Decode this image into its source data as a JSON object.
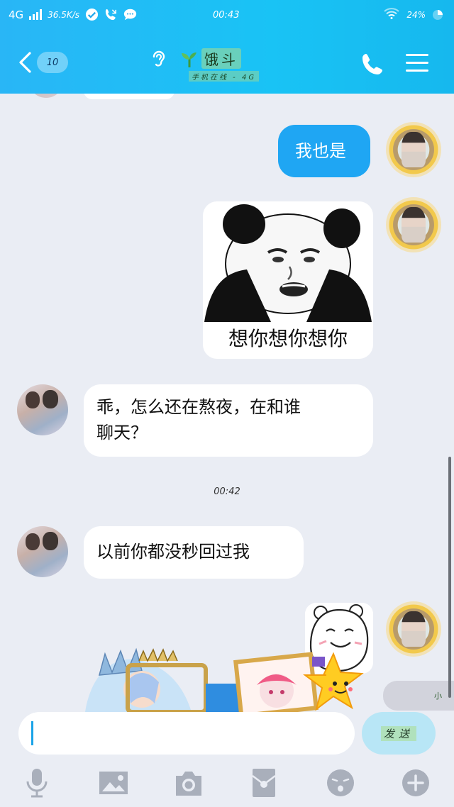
{
  "status_bar": {
    "network": "4G",
    "speed": "36.5K/s",
    "time": "00:43",
    "battery": "24%"
  },
  "header": {
    "unread_count": "10",
    "contact_name": "饿斗",
    "contact_status": "手机在线 - 4G"
  },
  "messages": [
    {
      "sender": "self",
      "type": "text",
      "text": "我也是"
    },
    {
      "sender": "self",
      "type": "sticker",
      "caption": "想你想你想你",
      "icon": "panda-meme-icon"
    },
    {
      "sender": "other",
      "type": "text",
      "line1": "乖，怎么还在熬夜，在和谁",
      "line2": "聊天？"
    },
    {
      "sender": "other",
      "type": "text",
      "text": "以前你都没秒回过我"
    },
    {
      "sender": "self",
      "type": "sticker",
      "icon": "bear-sticker-icon"
    }
  ],
  "timestamp": "00:42",
  "floating_badge": "小",
  "input": {
    "value": "",
    "send_label": "发送"
  },
  "toolbar": [
    "microphone-icon",
    "image-icon",
    "camera-icon",
    "red-packet-icon",
    "emoji-icon",
    "plus-icon"
  ],
  "colors": {
    "header_start": "#29b6f6",
    "header_end": "#16b8ee",
    "self_bubble": "#1fa6f3",
    "chat_background": "#eaedf4",
    "toolbar_icon": "#a9afbb"
  }
}
